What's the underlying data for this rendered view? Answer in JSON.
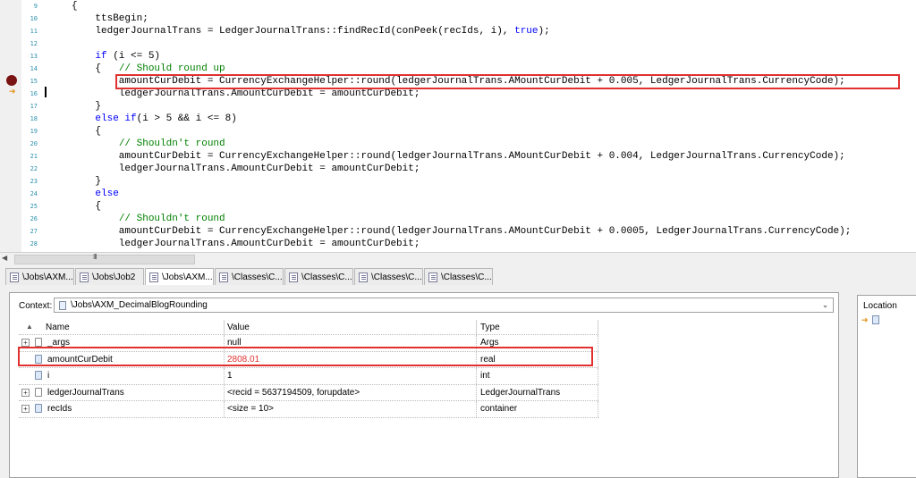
{
  "editor": {
    "line_numbers": [
      "9",
      "10",
      "11",
      "12",
      "13",
      "14",
      "15",
      "16",
      "17",
      "18",
      "19",
      "20",
      "21",
      "22",
      "23",
      "24",
      "25",
      "26",
      "27",
      "28"
    ],
    "lines": [
      "{",
      "    ttsBegin;",
      "    ledgerJournalTrans = LedgerJournalTrans::findRecId(conPeek(recIds, i), true);",
      "",
      "    if (i <= 5)",
      "    {   // Should round up",
      "        amountCurDebit = CurrencyExchangeHelper::round(ledgerJournalTrans.AMountCurDebit + 0.005, LedgerJournalTrans.CurrencyCode);",
      "        ledgerJournalTrans.AmountCurDebit = amountCurDebit;",
      "    }",
      "    else if(i > 5 && i <= 8)",
      "    {",
      "        // Shouldn't round",
      "        amountCurDebit = CurrencyExchangeHelper::round(ledgerJournalTrans.AMountCurDebit + 0.004, LedgerJournalTrans.CurrencyCode);",
      "        ledgerJournalTrans.AmountCurDebit = amountCurDebit;",
      "    }",
      "    else",
      "    {",
      "        // Shouldn't round",
      "        amountCurDebit = CurrencyExchangeHelper::round(ledgerJournalTrans.AMountCurDebit + 0.0005, LedgerJournalTrans.CurrencyCode);",
      "        ledgerJournalTrans.AmountCurDebit = amountCurDebit;"
    ],
    "current_line_number": "15"
  },
  "scrollbar": {
    "grip": "III"
  },
  "tabs": [
    {
      "label": "\\Jobs\\AXM...",
      "active": false
    },
    {
      "label": "\\Jobs\\Job2",
      "active": false
    },
    {
      "label": "\\Jobs\\AXM...",
      "active": true
    },
    {
      "label": "\\Classes\\C...",
      "active": false
    },
    {
      "label": "\\Classes\\C...",
      "active": false
    },
    {
      "label": "\\Classes\\C...",
      "active": false
    },
    {
      "label": "\\Classes\\C...",
      "active": false
    }
  ],
  "variables": {
    "context_label": "Context:",
    "context_value": "\\Jobs\\AXM_DecimalBlogRounding",
    "columns": {
      "name": "Name",
      "value": "Value",
      "type": "Type"
    },
    "rows": [
      {
        "name": "_args",
        "value": "null",
        "type": "Args",
        "expandable": true,
        "icon": "table-icon"
      },
      {
        "name": "amountCurDebit",
        "value": "2808.01",
        "type": "real",
        "expandable": false,
        "icon": "variable-icon",
        "changed": true
      },
      {
        "name": "i",
        "value": "1",
        "type": "int",
        "expandable": false,
        "icon": "variable-icon"
      },
      {
        "name": "ledgerJournalTrans",
        "value": "<recid = 5637194509, forupdate>",
        "type": "LedgerJournalTrans",
        "expandable": true,
        "icon": "table-icon"
      },
      {
        "name": "recIds",
        "value": "<size = 10>",
        "type": "container",
        "expandable": true,
        "icon": "variable-icon"
      }
    ],
    "changed_value_color": "#e03030"
  },
  "location": {
    "header": "Location"
  },
  "colors": {
    "highlight_box": "#e03030",
    "keyword": "#0000ff",
    "comment": "#008000",
    "breakpoint": "#7a1414"
  }
}
